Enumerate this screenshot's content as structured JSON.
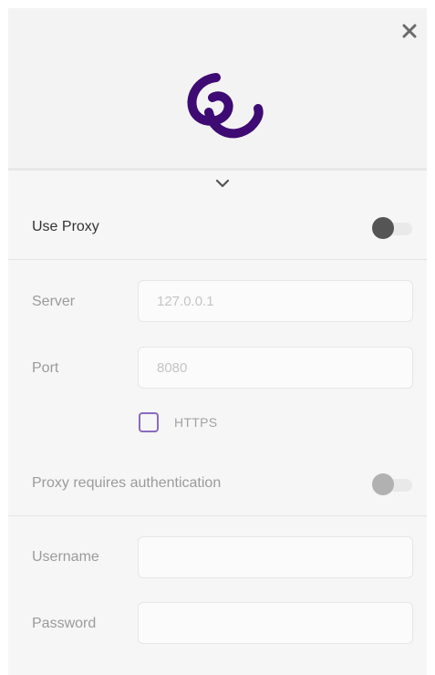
{
  "header": {
    "close_icon": "close-icon",
    "logo_icon": "swirl-logo-icon",
    "logo_color": "#3e0a73",
    "collapse_icon": "chevron-down-icon"
  },
  "proxy": {
    "use_proxy_label": "Use Proxy",
    "use_proxy_enabled": false,
    "server_label": "Server",
    "server_placeholder": "127.0.0.1",
    "server_value": "",
    "port_label": "Port",
    "port_placeholder": "8080",
    "port_value": "",
    "https_label": "HTTPS",
    "https_checked": false,
    "https_checkbox_color": "#8a6bc0"
  },
  "auth": {
    "requires_auth_label": "Proxy requires authentication",
    "requires_auth_enabled": false,
    "username_label": "Username",
    "username_value": "",
    "password_label": "Password",
    "password_value": ""
  }
}
